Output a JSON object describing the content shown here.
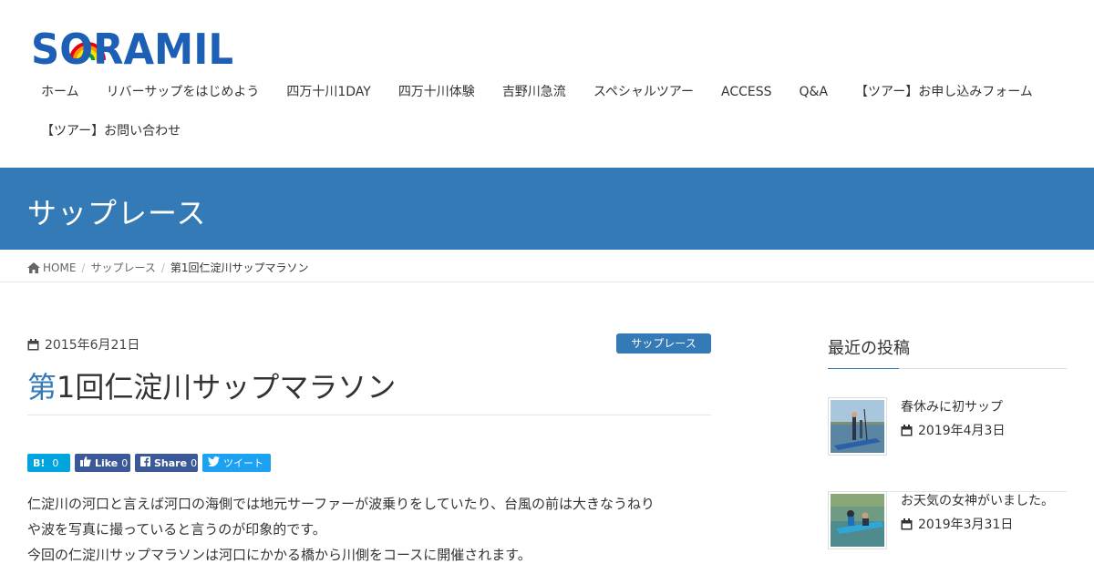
{
  "header": {
    "logo_text": "SORAMIL",
    "nav": [
      "ホーム",
      "リバーサップをはじめよう",
      "四万十川1DAY",
      "四万十川体験",
      "吉野川急流",
      "スペシャルツアー",
      "ACCESS",
      "Q&A",
      "【ツアー】お申し込みフォーム",
      "【ツアー】お問い合わせ"
    ]
  },
  "page_header": {
    "title": "サップレース"
  },
  "breadcrumb": {
    "home": "HOME",
    "category": "サップレース",
    "current": "第1回仁淀川サップマラソン"
  },
  "article": {
    "date": "2015年6月21日",
    "category": "サップレース",
    "title_first": "第",
    "title_rest": "1回仁淀川サップマラソン",
    "share": {
      "hatena_count": "0",
      "like_label": "Like",
      "like_count": "0",
      "share_label": "Share",
      "share_count": "0",
      "tweet_label": "ツイート"
    },
    "body": [
      "仁淀川の河口と言えば河口の海側では地元サーファーが波乗りをしていたり、台風の前は大きなうねり",
      "や波を写真に撮っていると言うのが印象的です。",
      "今回の仁淀川サップマラソンは河口にかかる橋から川側をコースに開催されます。"
    ]
  },
  "sidebar": {
    "title": "最近の投稿",
    "posts": [
      {
        "title": "春休みに初サップ",
        "date": "2019年4月3日"
      },
      {
        "title": "お天気の女神がいました。",
        "date": "2019年3月31日"
      }
    ]
  },
  "colors": {
    "accent": "#337ab7",
    "hatena": "#00a4de",
    "facebook": "#3b5998",
    "twitter": "#1da1f2"
  },
  "icons": [
    "home-icon",
    "calendar-icon",
    "hatena-icon",
    "thumbs-up-icon",
    "facebook-icon",
    "twitter-icon"
  ]
}
